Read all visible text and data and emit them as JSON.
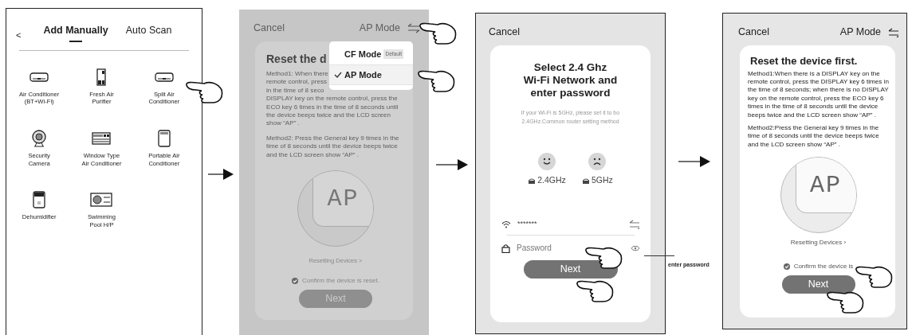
{
  "device_picker": {
    "back": "<",
    "tabs": [
      {
        "label": "Add Manually",
        "selected": true
      },
      {
        "label": "Auto Scan",
        "selected": false
      }
    ],
    "devices": [
      {
        "label": "Air Conditioner\n(BT+Wi-Fi)",
        "kind": "wall-unit"
      },
      {
        "label": "Fresh Air\nPurifier",
        "kind": "tower"
      },
      {
        "label": "Split Air\nConditioner",
        "kind": "wall-unit"
      },
      {
        "label": "Security\nCamera",
        "kind": "camera"
      },
      {
        "label": "Window Type\nAir Conditioner",
        "kind": "window-unit"
      },
      {
        "label": "Portable Air\nConditioner",
        "kind": "portable"
      },
      {
        "label": "Dehumidifier",
        "kind": "dehumidifier"
      },
      {
        "label": "Swimming\nPool H/P",
        "kind": "pool"
      }
    ]
  },
  "mode_screen": {
    "cancel": "Cancel",
    "mode": "AP Mode",
    "title": "Reset the d",
    "method1_lines": [
      "Method1: When there",
      "remote control, press",
      "in the time of 8 seco",
      "DISPLAY key on the remote control, press the",
      "ECO key 6 times in the time of 8 seconds until",
      "the device beeps twice and the LCD screen",
      "show “AP” ."
    ],
    "method2": "Method2: Press the General key 9 times in the time of 8 seconds until the device beeps twice and the LCD screen show “AP” .",
    "display": "AP",
    "resetting": "Resetting Devices >",
    "confirm": {
      "label": "Confirm the device is reset.",
      "checked": true
    },
    "next": "Next",
    "menu": [
      {
        "label": "CF Mode",
        "badge": "Default",
        "selected": false
      },
      {
        "label": "AP Mode",
        "selected": true
      }
    ]
  },
  "wifi_screen": {
    "cancel": "Cancel",
    "title": "Select 2.4 Ghz\nWi-Fi Network and\nenter password",
    "hint": "If your Wi-Fi is 5GHz, please set it to bo 2.4GHz.Common router setting method",
    "bands": [
      {
        "label": "2.4GHz",
        "kind": "good"
      },
      {
        "label": "5GHz",
        "kind": "bad"
      }
    ],
    "network": "*******",
    "password": {
      "placeholder": "Password"
    },
    "next": "Next"
  },
  "callout": "enter password",
  "reset_screen": {
    "cancel": "Cancel",
    "mode": "AP Mode",
    "title": "Reset the device first.",
    "method1": "Method1:When there is a DISPLAY key on the remote control, press the DISPLAY key 6 times in the time of 8 seconds; when there is no DISPLAY key on the remote control, press the ECO key 6 times in the time of 8 seconds until the device beeps twice and the LCD screen show “AP” .",
    "method2": "Method2:Press the General key 9 times in the time of 8 seconds until the device beeps twice and the LCD screen show “AP” .",
    "display": "AP",
    "resetting": "Resetting Devices ›",
    "confirm": {
      "label": "Confirm the device is",
      "checked": true
    },
    "next": "Next"
  }
}
